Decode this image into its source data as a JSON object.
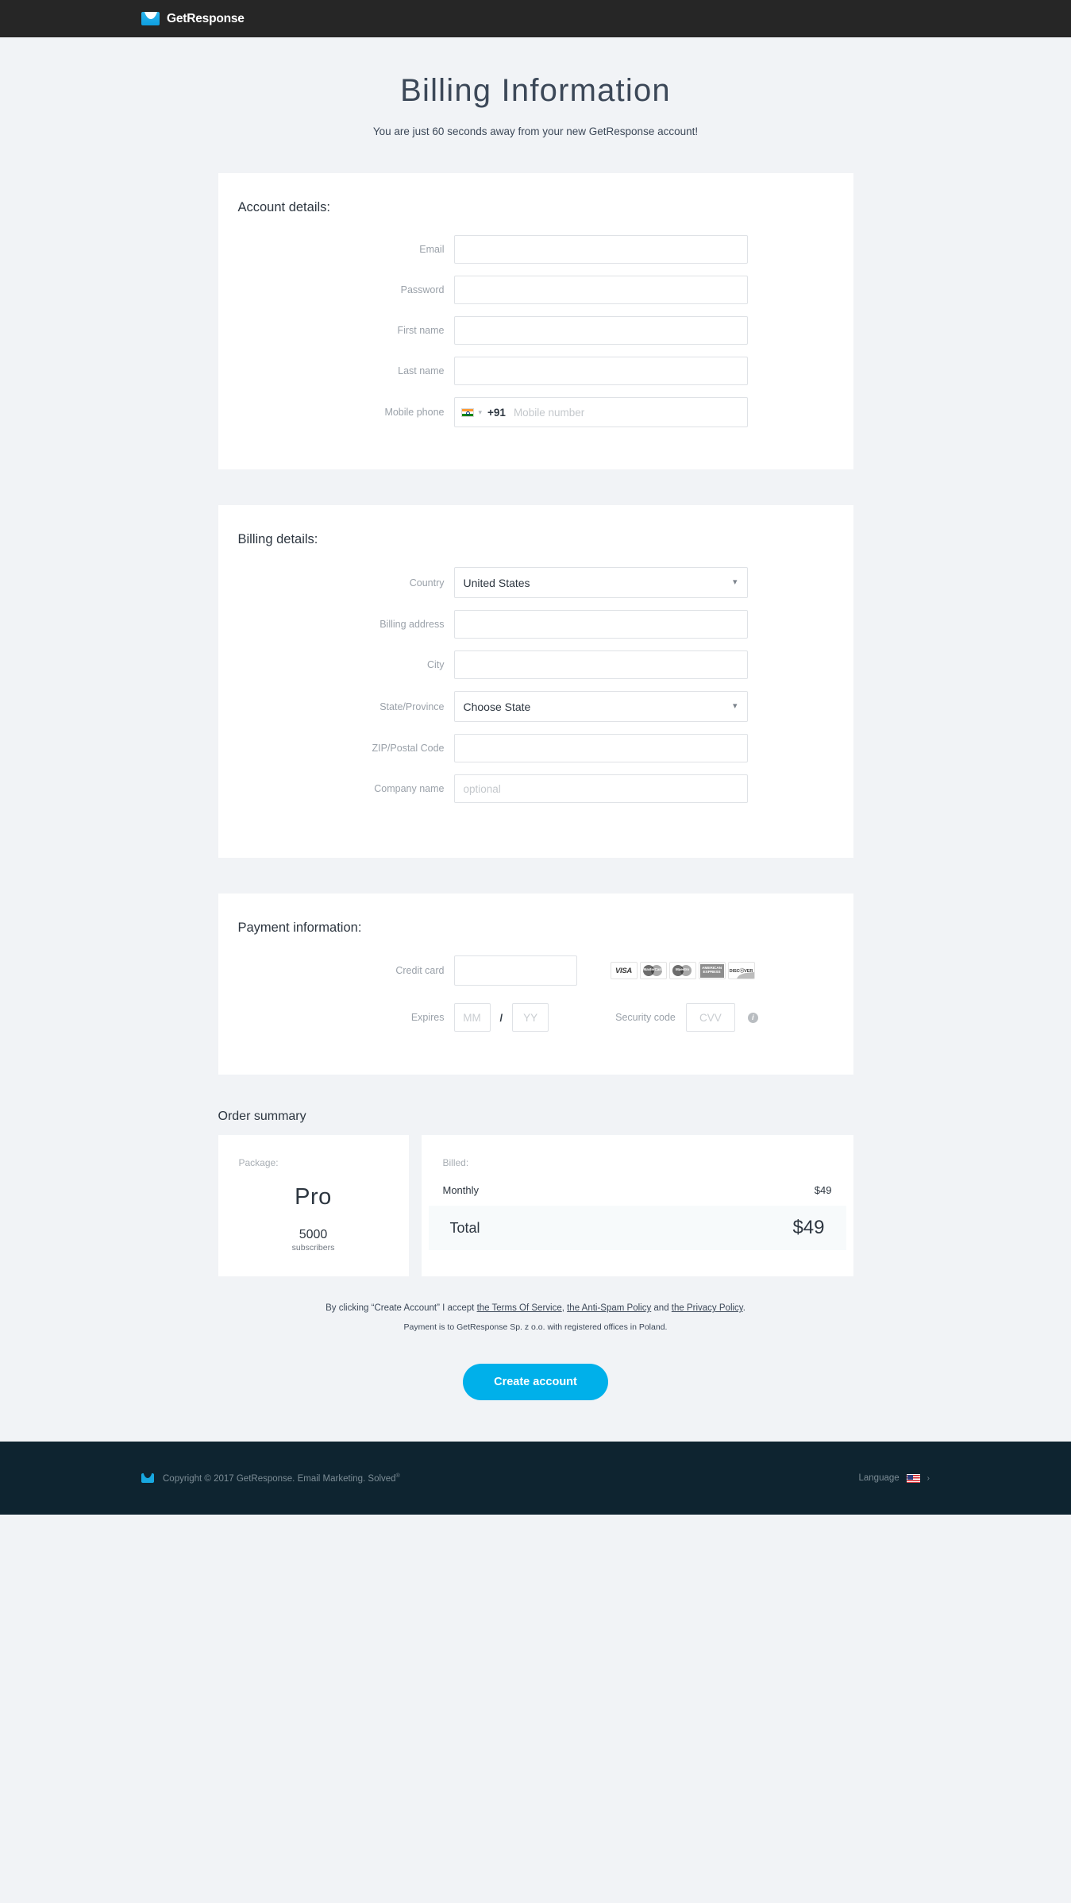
{
  "topbar": {
    "brand_name": "GetResponse"
  },
  "header": {
    "title": "Billing Information",
    "subtitle": "You are just 60 seconds away from your new GetResponse account!"
  },
  "account_details": {
    "title": "Account details:",
    "fields": [
      {
        "label": "Email",
        "value": "",
        "placeholder": ""
      },
      {
        "label": "Password",
        "value": "",
        "placeholder": ""
      },
      {
        "label": "First name",
        "value": "",
        "placeholder": ""
      },
      {
        "label": "Last name",
        "value": "",
        "placeholder": ""
      }
    ],
    "phone": {
      "label": "Mobile phone",
      "country_flag": "india-flag",
      "dial_code": "+91",
      "placeholder": "Mobile number",
      "value": ""
    }
  },
  "billing_details": {
    "title": "Billing details:",
    "country": {
      "label": "Country",
      "value": "United States"
    },
    "address": {
      "label": "Billing address",
      "value": "",
      "placeholder": ""
    },
    "city": {
      "label": "City",
      "value": "",
      "placeholder": ""
    },
    "state": {
      "label": "State/Province",
      "value": "Choose State"
    },
    "zip": {
      "label": "ZIP/Postal Code",
      "value": "",
      "placeholder": ""
    },
    "company": {
      "label": "Company name",
      "value": "",
      "placeholder": "optional"
    }
  },
  "payment": {
    "title": "Payment information:",
    "credit_card": {
      "label": "Credit card",
      "value": "",
      "placeholder": ""
    },
    "card_logos": [
      {
        "name": "visa-logo",
        "text": "VISA"
      },
      {
        "name": "mastercard-logo",
        "text": "MasterCard"
      },
      {
        "name": "maestro-logo",
        "text": "Maestro"
      },
      {
        "name": "amex-logo",
        "line1": "AMERICAN",
        "line2": "EXPRESS"
      },
      {
        "name": "discover-logo",
        "text": "DISCⓧVER"
      }
    ],
    "expires": {
      "label": "Expires",
      "month_placeholder": "MM",
      "year_placeholder": "YY",
      "separator": "/",
      "month_value": "",
      "year_value": ""
    },
    "security": {
      "label": "Security code",
      "placeholder": "CVV",
      "value": "",
      "help_icon": "info-icon",
      "help_glyph": "i"
    }
  },
  "order_summary": {
    "title": "Order summary",
    "package": {
      "label": "Package:",
      "name": "Pro",
      "count": "5000",
      "unit": "subscribers"
    },
    "billed": {
      "label": "Billed:",
      "cycle": "Monthly",
      "cycle_price": "$49",
      "total_label": "Total",
      "total_price": "$49"
    }
  },
  "terms": {
    "prefix": "By clicking “Create Account” I accept ",
    "link1": "the Terms Of Service",
    "sep1": ", ",
    "link2": "the Anti-Spam Policy",
    "sep2": " and ",
    "link3": "the Privacy Policy",
    "suffix": ".",
    "note": "Payment is to GetResponse Sp. z o.o. with registered offices in Poland."
  },
  "cta": {
    "label": "Create account"
  },
  "footer": {
    "copyright": "Copyright © 2017 GetResponse. Email Marketing. Solved",
    "copyright_sup": "®",
    "language_label": "Language",
    "language_flag": "us-flag",
    "chevron": "›"
  },
  "colors": {
    "accent": "#00b0ea",
    "page_bg": "#f1f3f6",
    "topbar_bg": "#262626",
    "footer_bg": "#0e2430"
  }
}
